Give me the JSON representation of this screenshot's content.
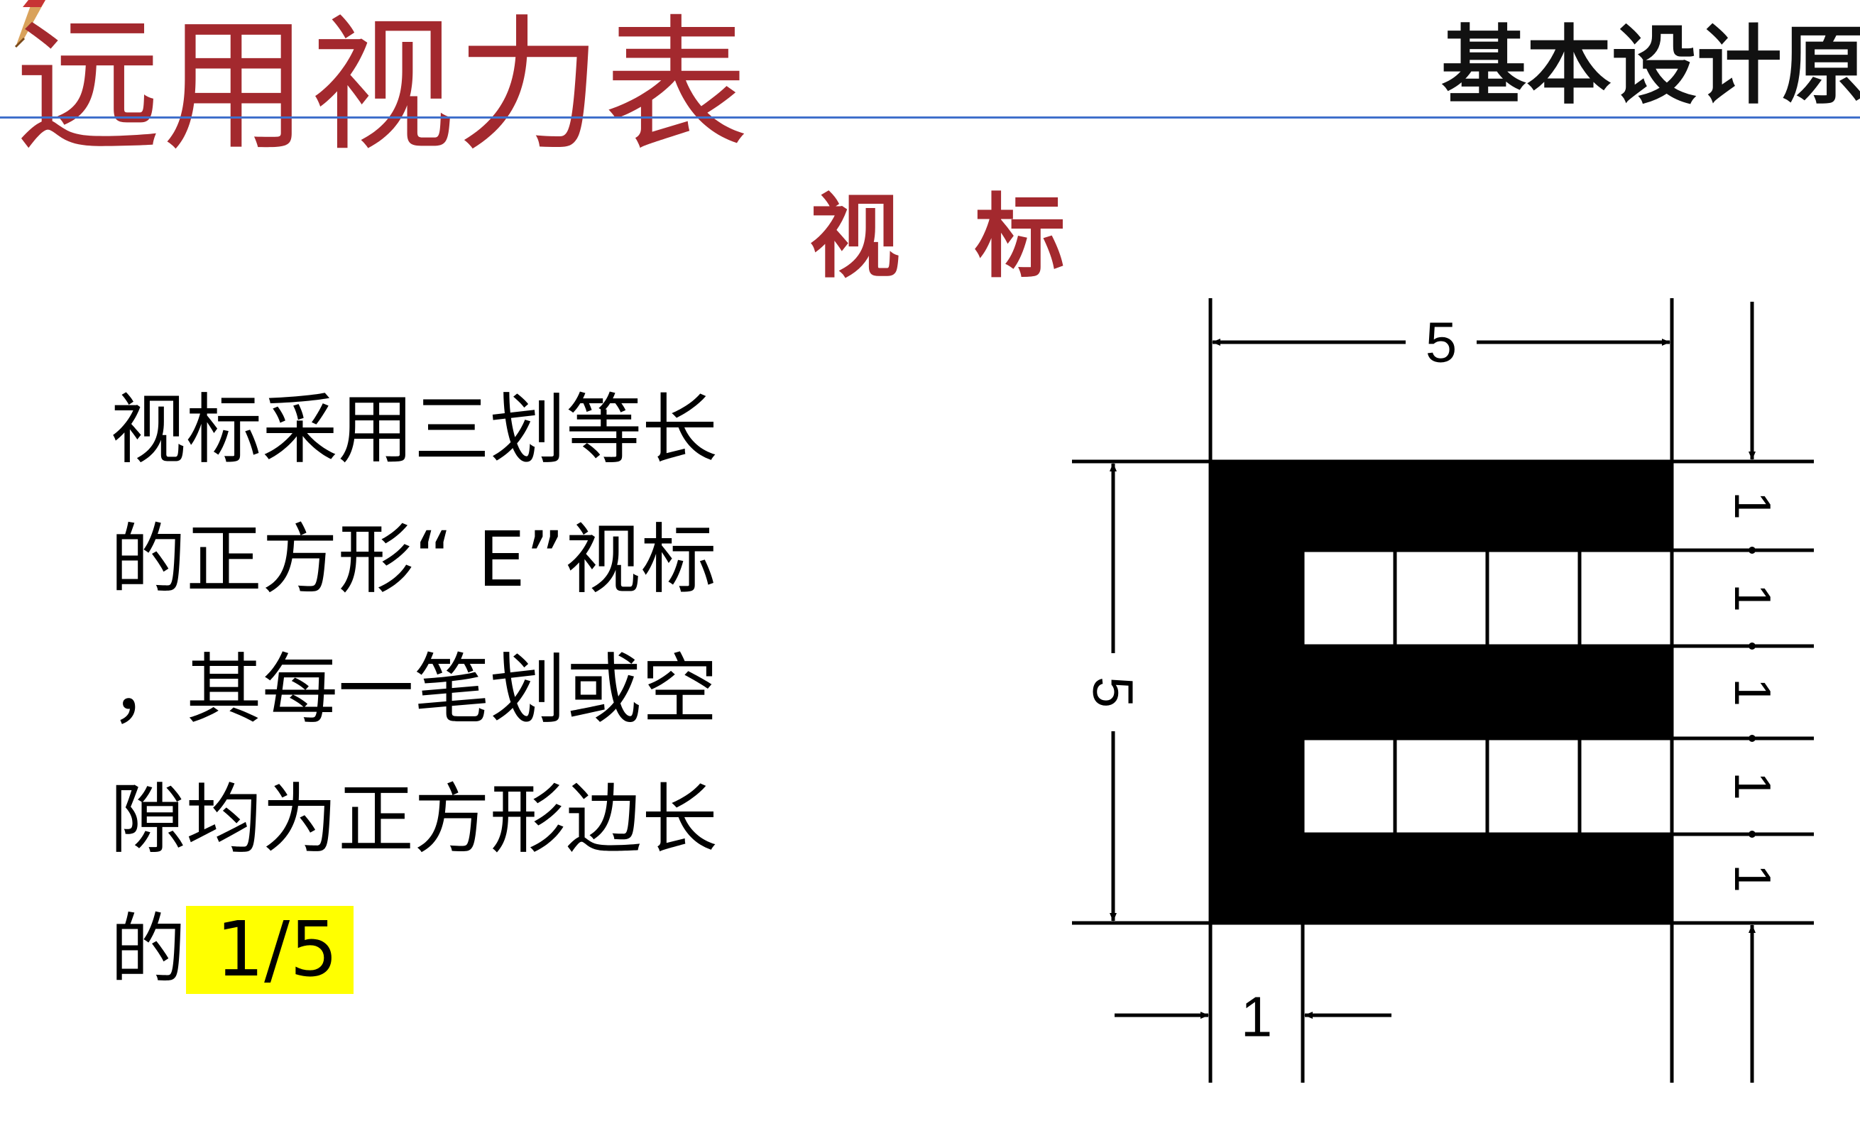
{
  "slide": {
    "title": "远用视力表",
    "header_right": "基本设计原",
    "subtitle": "视 标",
    "body": {
      "line1": "视标采用三划等长",
      "line2": "的正方形“ E”视标",
      "line3": "，其每一笔划或空",
      "line4": "隙均为正方形边长",
      "line5_prefix": "的",
      "line5_highlight": " 1/5"
    }
  },
  "diagram": {
    "top_width_label": "5",
    "left_height_label": "5",
    "bottom_width_label": "1",
    "right_segment_labels": [
      "1",
      "1",
      "1",
      "1",
      "1"
    ]
  },
  "colors": {
    "title": "#A3292E",
    "rule": "#3F6FCB",
    "highlight": "#FFFF00",
    "diagram_fill": "#000000"
  },
  "icons": {
    "corner": "pen-icon"
  }
}
